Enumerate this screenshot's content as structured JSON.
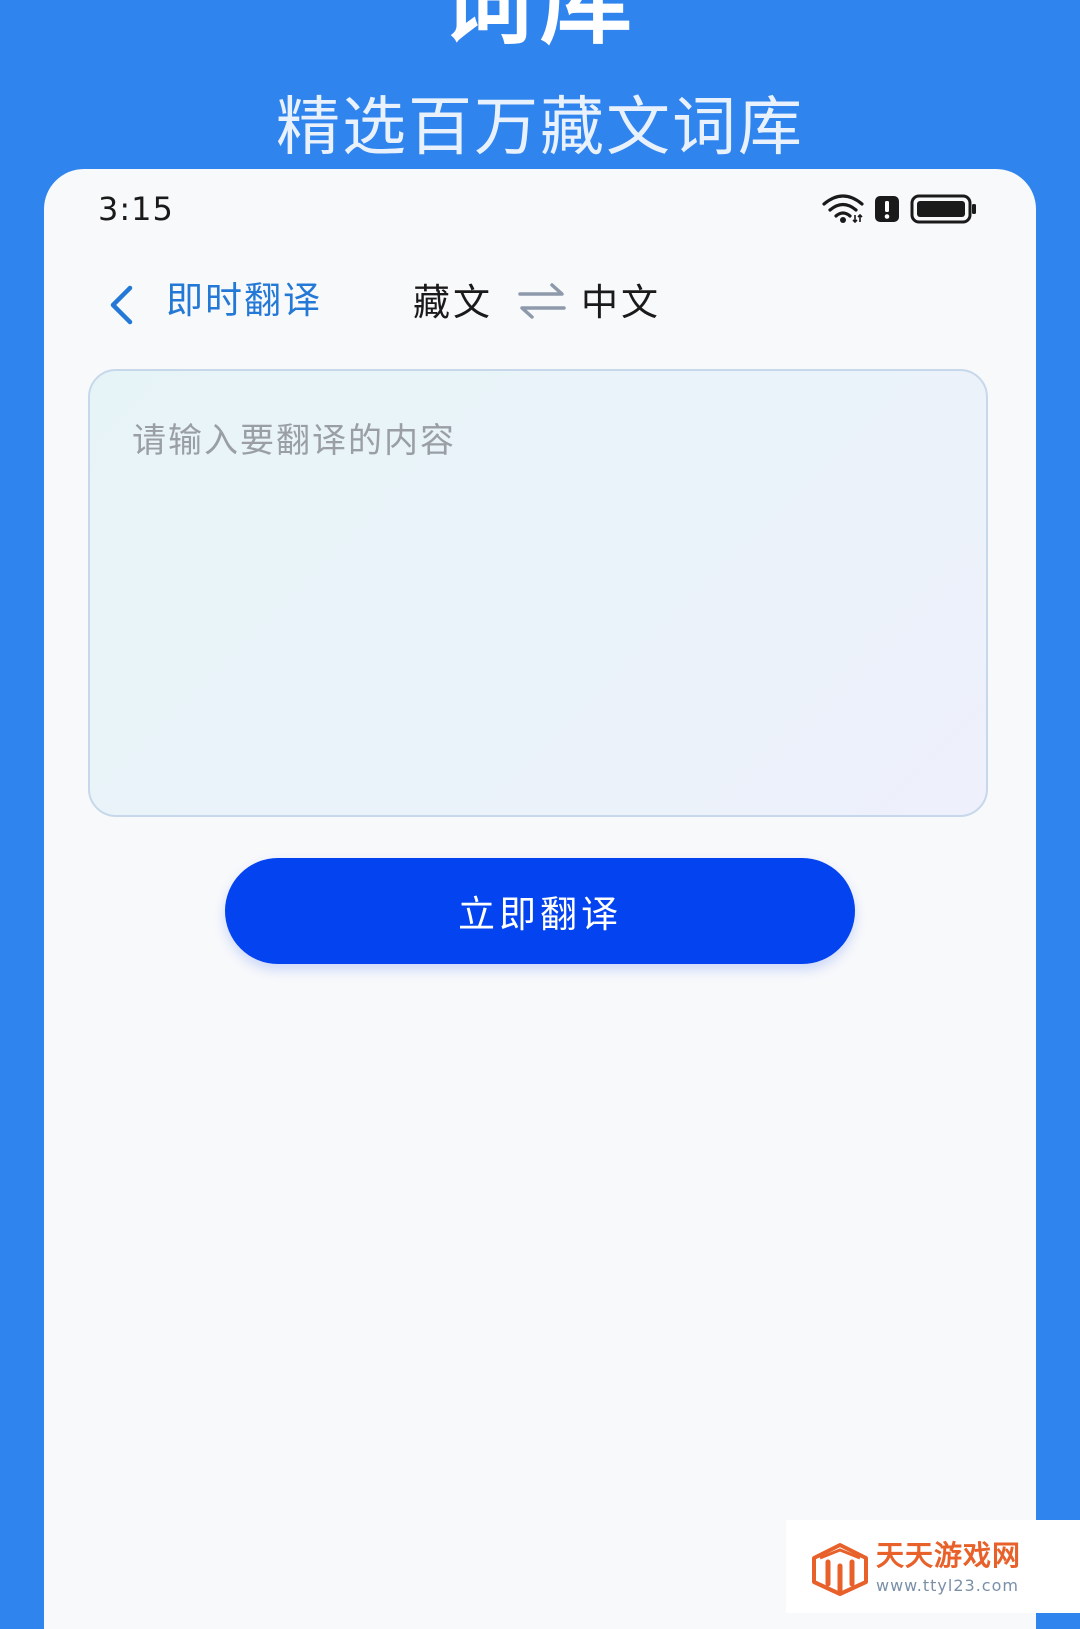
{
  "banner": {
    "title": "词库",
    "subtitle": "精选百万藏文词库"
  },
  "status_bar": {
    "time": "3:15",
    "icons": [
      "wifi-icon",
      "alert-icon",
      "battery-icon"
    ]
  },
  "header": {
    "back_icon": "chevron-left-icon",
    "title": "即时翻译",
    "source_language": "藏文",
    "swap_icon": "swap-arrows-icon",
    "target_language": "中文"
  },
  "input": {
    "placeholder": "请输入要翻译的内容",
    "value": ""
  },
  "actions": {
    "translate_label": "立即翻译"
  },
  "watermark": {
    "name": "天天游戏网",
    "url": "www.ttyl23.com"
  },
  "colors": {
    "background_blue": "#2F84EE",
    "accent_blue": "#2579D6",
    "button_blue": "#0343F0",
    "watermark_orange": "#E8612A"
  }
}
